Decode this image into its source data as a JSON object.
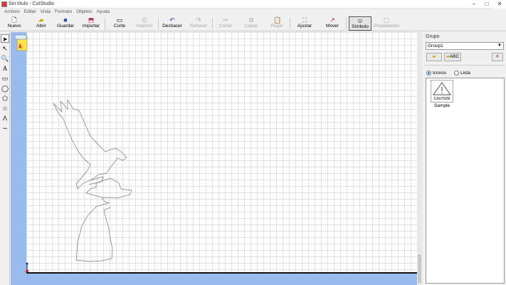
{
  "window": {
    "title": "Sin título - CutStudio",
    "minimize": "–",
    "maximize": "□",
    "close": "✕"
  },
  "menu": [
    "Archivo",
    "Editar",
    "Vista",
    "Formato",
    "Objetos",
    "Ayuda"
  ],
  "toolbar": {
    "nuevo": "Nuevo",
    "abrir": "Abrir",
    "guardar": "Guardar",
    "importar": "Importar",
    "corte": "Corte",
    "imprimir": "Imprimir",
    "deshacer": "Deshacer",
    "rehacer": "Rehacer",
    "cortar": "Cortar",
    "copiar": "Copiar",
    "pegar": "Pegar",
    "ajustar": "Ajustar",
    "mover": "Mover",
    "simbolo": "Símbolo",
    "propiedades": "Propiedades"
  },
  "panel": {
    "group_label": "Grupo",
    "group_value": "Group1",
    "abc_button": "ABC",
    "view_icons": "Iconos",
    "view_list": "Lista",
    "symbol_text": "CAUTION",
    "symbol_label": "Sample"
  },
  "colors": {
    "canvas_bg": "#99bbee",
    "accent": "#2a6ccc"
  }
}
